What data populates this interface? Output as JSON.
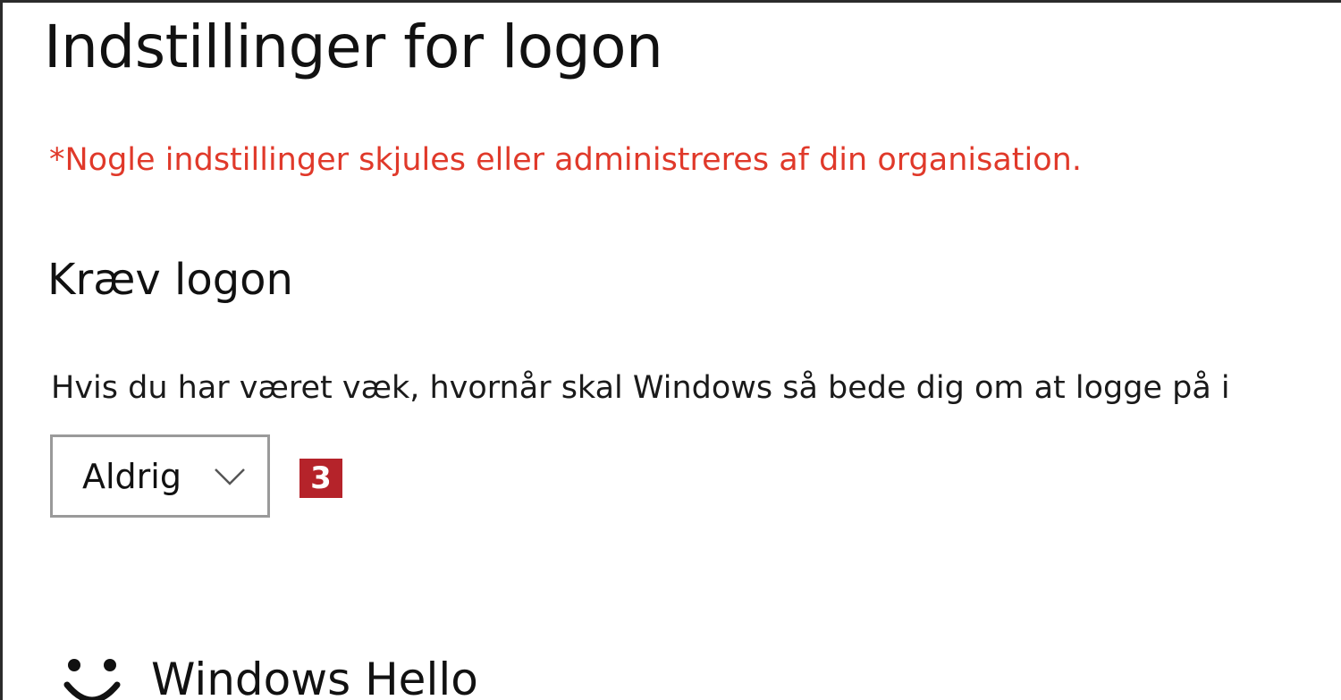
{
  "page": {
    "title": "Indstillinger for logon",
    "org_notice": "*Nogle indstillinger skjules eller administreres af din organisation."
  },
  "require_signin": {
    "heading": "Kræv logon",
    "question": "Hvis du har været væk, hvornår skal Windows så bede dig om at logge på i",
    "dropdown": {
      "selected": "Aldrig",
      "icon": "chevron-down-icon"
    },
    "badge": "3"
  },
  "windows_hello": {
    "icon": "smile-icon",
    "label": "Windows Hello"
  },
  "colors": {
    "notice": "#e0392a",
    "badge": "#b5232a",
    "dropdown_border": "#9a9a9a"
  }
}
